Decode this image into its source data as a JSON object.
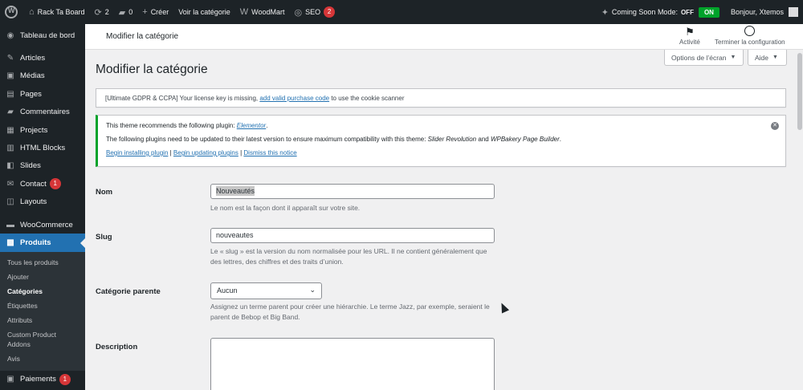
{
  "adminbar": {
    "site_name": "Rack Ta Board",
    "updates_count": "2",
    "comments_count": "0",
    "create_label": "Créer",
    "view_category_label": "Voir la catégorie",
    "woodmart_label": "WoodMart",
    "seo_label": "SEO",
    "seo_badge": "2",
    "coming_soon_label": "Coming Soon Mode:",
    "off_label": "OFF",
    "on_label": "ON",
    "greeting": "Bonjour, Xtemos"
  },
  "sidebar": {
    "dashboard": "Tableau de bord",
    "articles": "Articles",
    "medias": "Médias",
    "pages": "Pages",
    "comments": "Commentaires",
    "projects": "Projects",
    "html_blocks": "HTML Blocks",
    "slides": "Slides",
    "contact": "Contact",
    "contact_badge": "1",
    "layouts": "Layouts",
    "woocommerce": "WooCommerce",
    "products": "Produits",
    "submenu": {
      "all_products": "Tous les produits",
      "add": "Ajouter",
      "categories": "Catégories",
      "tags": "Étiquettes",
      "attributes": "Attributs",
      "custom_addons": "Custom Product Addons",
      "reviews": "Avis"
    },
    "payments": "Paiements",
    "payments_badge": "1"
  },
  "header": {
    "title": "Modifier la catégorie",
    "activity": "Activité",
    "finish_setup": "Terminer la configuration"
  },
  "screen_options": {
    "options_label": "Options de l’écran",
    "help_label": "Aide"
  },
  "page": {
    "title": "Modifier la catégorie"
  },
  "notices": {
    "gdpr_prefix": "[Ultimate GDPR & CCPA] Your license key is missing, ",
    "gdpr_link": "add valid purchase code",
    "gdpr_suffix": " to use the cookie scanner",
    "plugin_line1_prefix": "This theme recommends the following plugin: ",
    "plugin_line1_link": "Elementor",
    "plugin_line1_suffix": ".",
    "plugin_line2_prefix": "The following plugins need to be updated to their latest version to ensure maximum compatibility with this theme: ",
    "plugin_line2_em1": "Slider Revolution",
    "plugin_line2_and": " and ",
    "plugin_line2_em2": "WPBakery Page Builder",
    "plugin_line2_suffix": ".",
    "begin_installing": "Begin installing plugin",
    "begin_updating": "Begin updating plugins",
    "dismiss": "Dismiss this notice",
    "sep": " | "
  },
  "form": {
    "name_label": "Nom",
    "name_value": "Nouveautés",
    "name_help": "Le nom est la façon dont il apparaît sur votre site.",
    "slug_label": "Slug",
    "slug_value": "nouveautes",
    "slug_help": "Le « slug » est la version du nom normalisée pour les URL. Il ne contient généralement que des lettres, des chiffres et des traits d’union.",
    "parent_label": "Catégorie parente",
    "parent_value": "Aucun",
    "parent_help": "Assignez un terme parent pour créer une hiérarchie. Le terme Jazz, par exemple, seraient le parent de Bebop et Big Band.",
    "description_label": "Description"
  },
  "colors": {
    "adminbar_bg": "#1d2327",
    "accent": "#2271b1",
    "success": "#00a32a",
    "badge": "#d63638"
  }
}
